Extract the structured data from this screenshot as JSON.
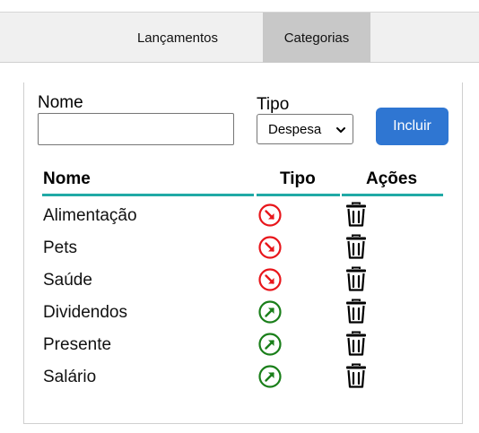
{
  "tabs": [
    {
      "label": "Lançamentos",
      "active": false
    },
    {
      "label": "Categorias",
      "active": true
    }
  ],
  "form": {
    "nome_label": "Nome",
    "nome_value": "",
    "tipo_label": "Tipo",
    "tipo_selected": "Despesa",
    "submit_label": "Incluir"
  },
  "table": {
    "headers": [
      "Nome",
      "Tipo",
      "Ações"
    ],
    "rows": [
      {
        "name": "Alimentação",
        "tipo": "expense"
      },
      {
        "name": "Pets",
        "tipo": "expense"
      },
      {
        "name": "Saúde",
        "tipo": "expense"
      },
      {
        "name": "Dividendos",
        "tipo": "income"
      },
      {
        "name": "Presente",
        "tipo": "income"
      },
      {
        "name": "Salário",
        "tipo": "income"
      }
    ]
  },
  "icons": {
    "expense": "arrow-down-right-circle-icon",
    "income": "arrow-up-right-circle-icon",
    "delete": "trash-icon",
    "select": "chevron-down-icon"
  },
  "colors": {
    "expense": "#e8161b",
    "income": "#1a7f1a",
    "accent": "#20aaa6",
    "button": "#2f76d2",
    "active_tab": "#c8c8c8"
  }
}
